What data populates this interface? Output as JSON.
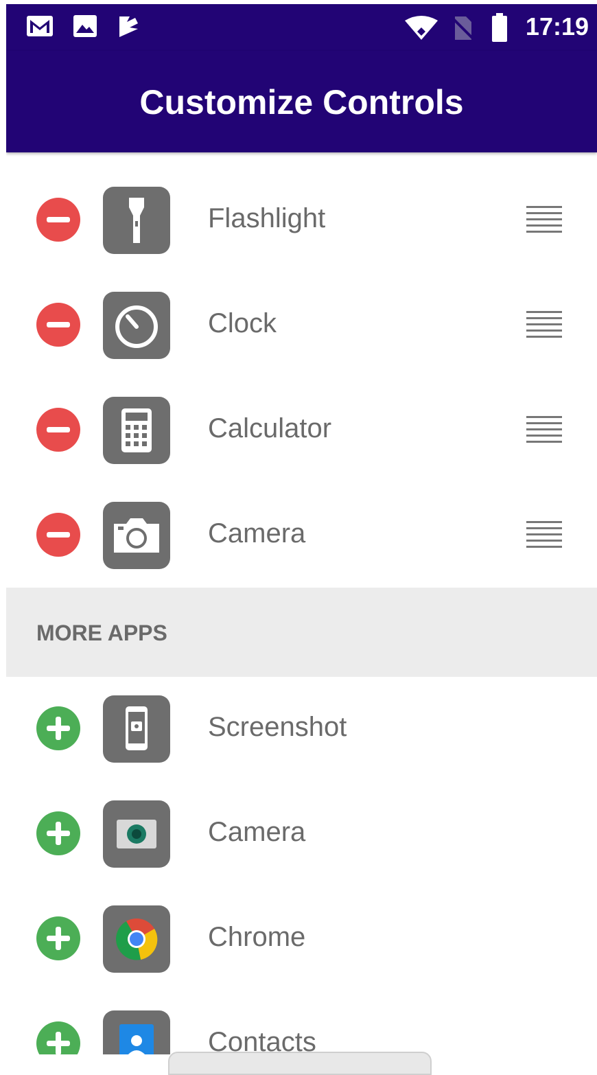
{
  "status_bar": {
    "time": "17:19",
    "left_icons": [
      "gmail-icon",
      "image-icon",
      "task-icon"
    ],
    "right_icons": [
      "wifi-icon",
      "no-sim-icon",
      "battery-icon"
    ]
  },
  "app_bar": {
    "title": "Customize Controls"
  },
  "active_controls": [
    {
      "label": "Flashlight",
      "icon": "flashlight-icon"
    },
    {
      "label": "Clock",
      "icon": "timer-icon"
    },
    {
      "label": "Calculator",
      "icon": "calculator-icon"
    },
    {
      "label": "Camera",
      "icon": "camera-icon"
    }
  ],
  "more_apps": {
    "section_label": "MORE APPS",
    "items": [
      {
        "label": "Screenshot",
        "icon": "screenshot-icon"
      },
      {
        "label": "Camera",
        "icon": "camera-app-icon"
      },
      {
        "label": "Chrome",
        "icon": "chrome-icon"
      },
      {
        "label": "Contacts",
        "icon": "contacts-icon"
      }
    ]
  },
  "colors": {
    "primary": "#220475",
    "remove": "#e84c4c",
    "add": "#4cae56",
    "tile": "#6e6e6e"
  }
}
